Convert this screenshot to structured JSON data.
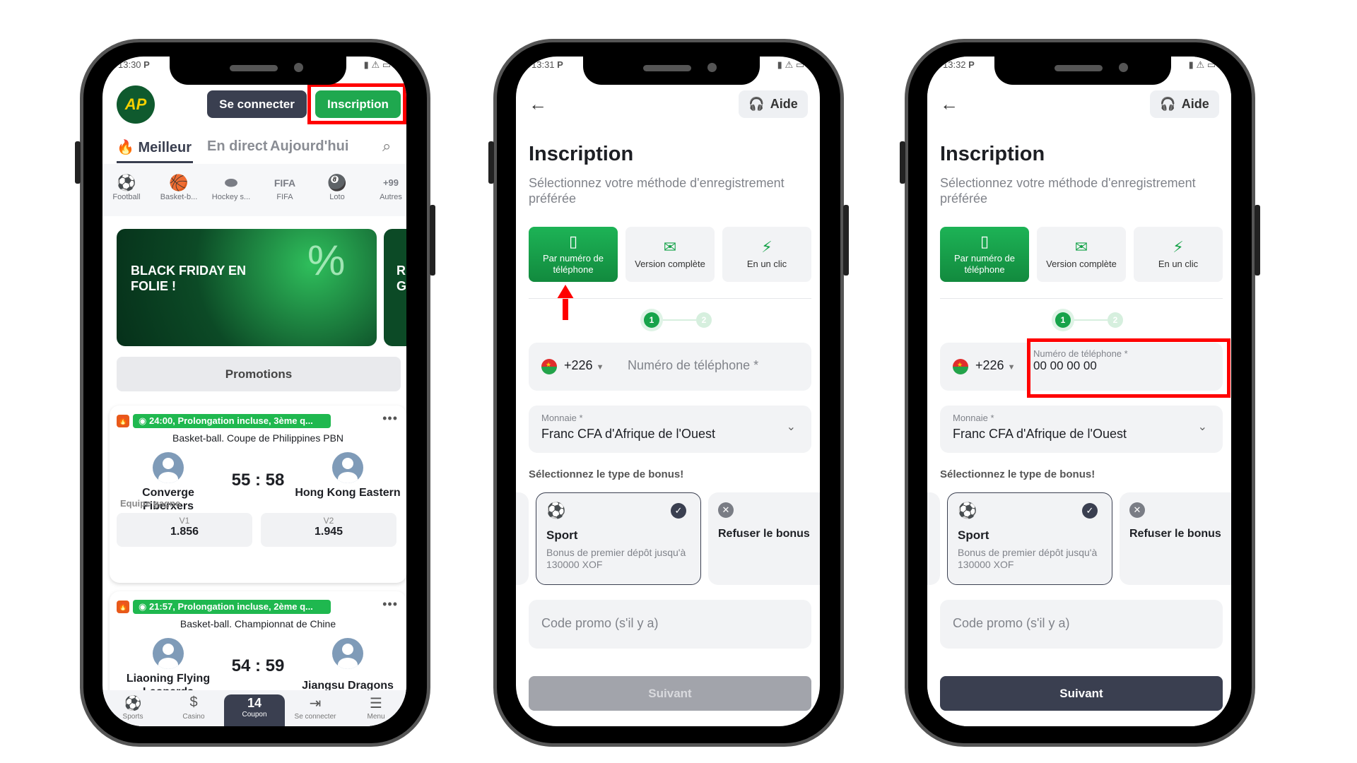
{
  "colors": {
    "brand_green": "#1fa84f",
    "dark": "#3a3f50",
    "highlight_red": "#ff0000",
    "disabled": "#a2a4ab"
  },
  "phone1": {
    "status_time": "13:30",
    "status_carrier": "P",
    "logo_text": "AP",
    "login_label": "Se connecter",
    "signup_label": "Inscription",
    "tabs": [
      "Meilleur",
      "En direct",
      "Aujourd'hui"
    ],
    "sports": [
      {
        "icon": "football-icon",
        "label": "Football"
      },
      {
        "icon": "basketball-icon",
        "label": "Basket-b..."
      },
      {
        "icon": "hockey-puck-icon",
        "label": "Hockey s..."
      },
      {
        "icon": "fifa-icon",
        "label": "FIFA",
        "glyph": "FIFA"
      },
      {
        "icon": "lotto-balls-icon",
        "label": "Loto"
      },
      {
        "icon": "more-icon",
        "label": "Autres",
        "glyph": "+99"
      }
    ],
    "banner_text": "BLACK FRIDAY EN FOLIE !",
    "banner2_text": "RE GR",
    "promotions_label": "Promotions",
    "matches": [
      {
        "live": "24:00, Prolongation incluse, 3ème q...",
        "league": "Basket-ball. Coupe de Philippines PBN",
        "team1": "Converge Fiberxers",
        "team2": "Hong Kong Eastern",
        "score": "55 : 58",
        "market": "Equipe gagne",
        "odds": [
          {
            "label": "V1",
            "value": "1.856"
          },
          {
            "label": "V2",
            "value": "1.945"
          }
        ]
      },
      {
        "live": "21:57, Prolongation incluse, 2ème q...",
        "league": "Basket-ball. Championnat de Chine",
        "team1": "Liaoning Flying Leopards",
        "team2": "Jiangsu Dragons",
        "score": "54 : 59"
      }
    ],
    "nav": [
      {
        "icon": "football-icon",
        "label": "Sports"
      },
      {
        "icon": "casino-chip-icon",
        "label": "Casino"
      },
      {
        "icon": "coupon",
        "label": "Coupon",
        "count": "14"
      },
      {
        "icon": "login-icon",
        "label": "Se connecter"
      },
      {
        "icon": "menu-icon",
        "label": "Menu"
      }
    ]
  },
  "reg": {
    "help_label": "Aide",
    "title": "Inscription",
    "subtitle": "Sélectionnez votre méthode d'enregistrement préférée",
    "methods": [
      "Par numéro de téléphone",
      "Version complète",
      "En un clic"
    ],
    "steps": [
      "1",
      "2"
    ],
    "country_code": "+226",
    "phone_placeholder": "Numéro de téléphone *",
    "currency_label": "Monnaie *",
    "currency_value": "Franc CFA d'Afrique de l'Ouest",
    "bonus_heading": "Sélectionnez le type de bonus!",
    "bonus_sport_title": "Sport",
    "bonus_sport_desc": "Bonus de premier dépôt jusqu'à 130000 XOF",
    "bonus_refuse": "Refuser le bonus",
    "promo_placeholder": "Code promo (s'il y a)",
    "next_label": "Suivant"
  },
  "phone2": {
    "status_time": "13:31",
    "status_carrier": "P",
    "next_enabled": false
  },
  "phone3": {
    "status_time": "13:32",
    "status_carrier": "P",
    "phone_value": "00 00 00 00",
    "next_enabled": true
  }
}
